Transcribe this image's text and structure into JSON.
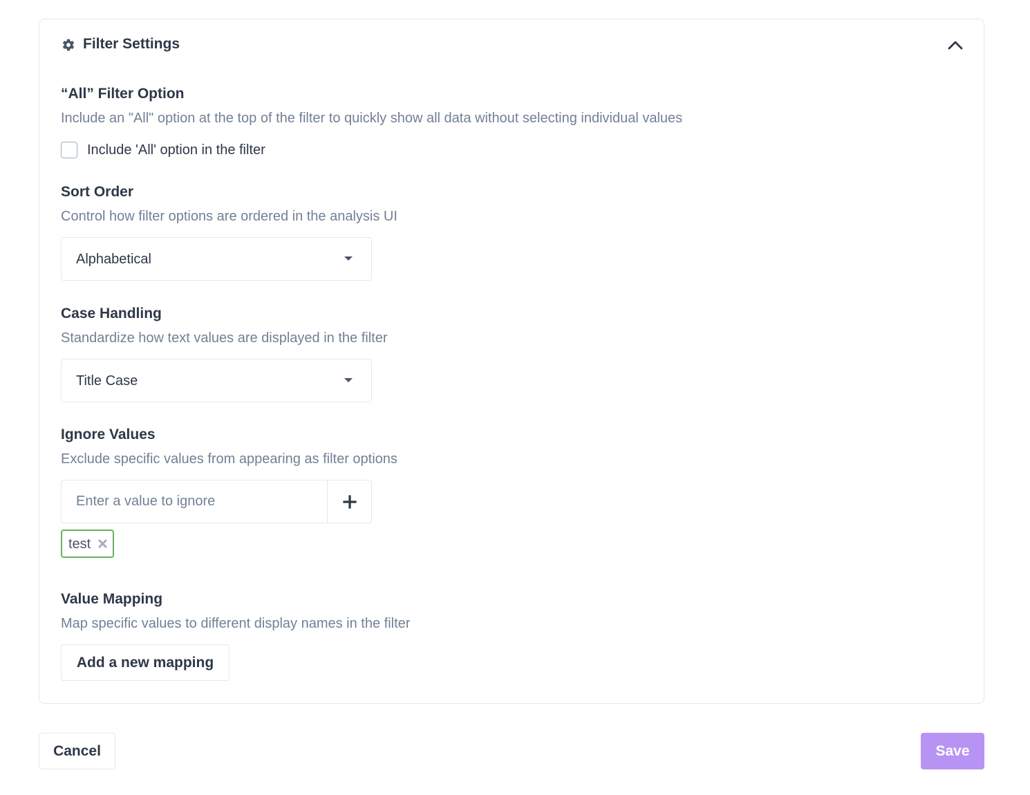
{
  "panel": {
    "title": "Filter Settings",
    "icon": "gear-icon",
    "collapse_icon": "chevron-up-icon"
  },
  "all_option": {
    "title": "“All” Filter Option",
    "description": "Include an \"All\" option at the top of the filter to quickly show all data without selecting individual values",
    "checkbox_label": "Include 'All' option in the filter",
    "checked": false
  },
  "sort_order": {
    "title": "Sort Order",
    "description": "Control how filter options are ordered in the analysis UI",
    "selected": "Alphabetical"
  },
  "case_handling": {
    "title": "Case Handling",
    "description": "Standardize how text values are displayed in the filter",
    "selected": "Title Case"
  },
  "ignore_values": {
    "title": "Ignore Values",
    "description": "Exclude specific values from appearing as filter options",
    "placeholder": "Enter a value to ignore",
    "value": "",
    "tags": [
      "test"
    ]
  },
  "value_mapping": {
    "title": "Value Mapping",
    "description": "Map specific values to different display names in the filter",
    "add_button_label": "Add a new mapping"
  },
  "footer": {
    "cancel_label": "Cancel",
    "save_label": "Save"
  },
  "colors": {
    "accent_save": "#b794f4",
    "tag_border": "#68b25f",
    "text_primary": "#2d3748",
    "text_muted": "#718096",
    "border": "#e2e8f0"
  }
}
